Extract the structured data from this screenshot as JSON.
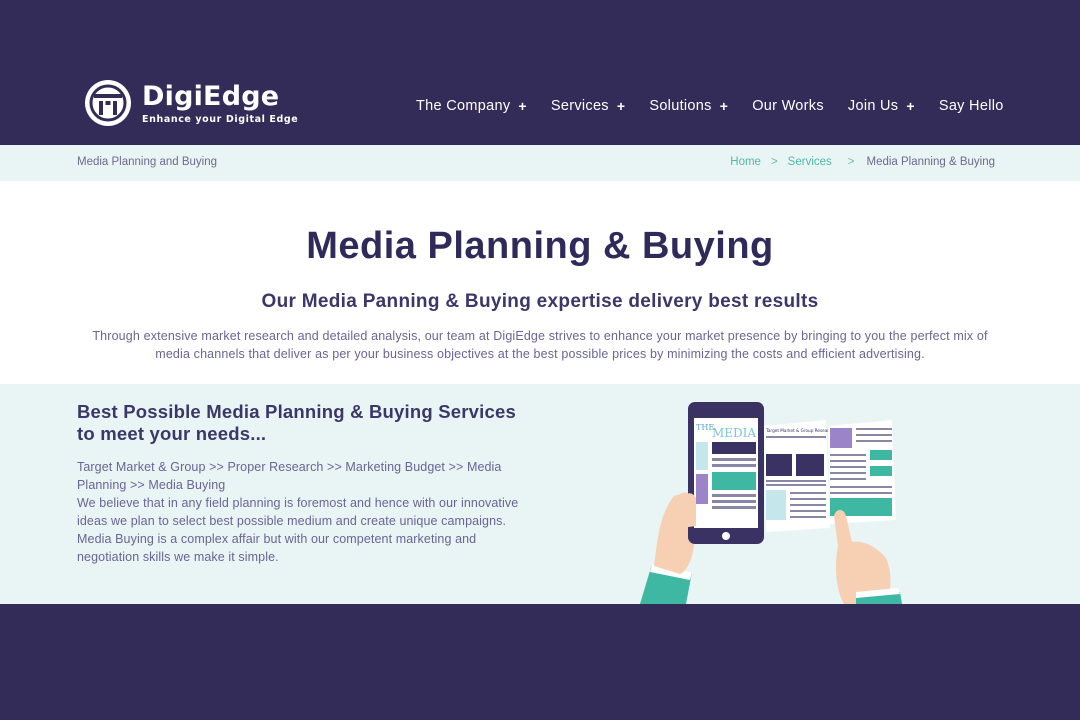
{
  "brand": {
    "name": "DigiEdge",
    "tagline": "Enhance your Digital Edge"
  },
  "nav": {
    "items": [
      {
        "label": "The Company",
        "has_submenu": true
      },
      {
        "label": "Services",
        "has_submenu": true
      },
      {
        "label": "Solutions",
        "has_submenu": true
      },
      {
        "label": "Our Works",
        "has_submenu": false
      },
      {
        "label": "Join Us",
        "has_submenu": true
      },
      {
        "label": "Say Hello",
        "has_submenu": false
      }
    ],
    "submenu_glyph": "+"
  },
  "breadcrumb": {
    "page_label": "Media Planning and Buying",
    "home": "Home",
    "services": "Services",
    "current": "Media Planning & Buying",
    "separator": ">"
  },
  "main": {
    "title": "Media Planning & Buying",
    "subtitle": "Our Media Panning & Buying expertise delivery best results",
    "intro": "Through extensive market research and detailed analysis, our team at DigiEdge strives to enhance your market presence by bringing to you the perfect mix of media channels that deliver as per your business objectives at the best possible prices by minimizing the costs and efficient advertising."
  },
  "feature": {
    "title": "Best Possible Media Planning & Buying Services to meet your needs...",
    "steps": "Target Market & Group >> Proper Research >> Marketing Budget >> Media Planning >> Media Buying",
    "body": "We believe that in any field planning is foremost and hence with our innovative ideas we plan to select best possible medium and create unique campaigns. Media Buying is a complex affair but with our competent marketing and negotiation skills we make it simple.",
    "illustration": {
      "phone_masthead_small": "THE",
      "phone_masthead": "MEDIA",
      "paper_headline": "Target Market & Group Research"
    }
  },
  "colors": {
    "header_bg": "#332b58",
    "breadcrumb_bg": "#e9f4f4",
    "accent_teal": "#4fb8a8",
    "title_text": "#2f2a5a",
    "body_text": "#6a6593"
  }
}
